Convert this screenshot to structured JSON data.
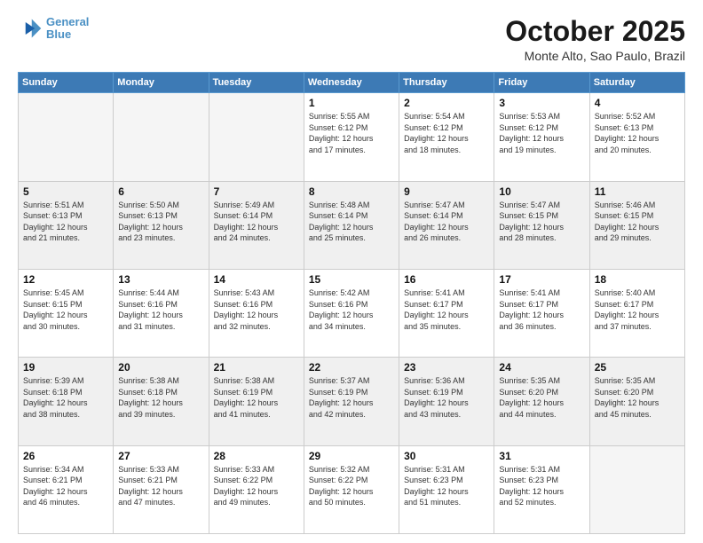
{
  "header": {
    "logo_line1": "General",
    "logo_line2": "Blue",
    "month": "October 2025",
    "location": "Monte Alto, Sao Paulo, Brazil"
  },
  "weekdays": [
    "Sunday",
    "Monday",
    "Tuesday",
    "Wednesday",
    "Thursday",
    "Friday",
    "Saturday"
  ],
  "weeks": [
    [
      {
        "day": "",
        "info": ""
      },
      {
        "day": "",
        "info": ""
      },
      {
        "day": "",
        "info": ""
      },
      {
        "day": "1",
        "info": "Sunrise: 5:55 AM\nSunset: 6:12 PM\nDaylight: 12 hours\nand 17 minutes."
      },
      {
        "day": "2",
        "info": "Sunrise: 5:54 AM\nSunset: 6:12 PM\nDaylight: 12 hours\nand 18 minutes."
      },
      {
        "day": "3",
        "info": "Sunrise: 5:53 AM\nSunset: 6:12 PM\nDaylight: 12 hours\nand 19 minutes."
      },
      {
        "day": "4",
        "info": "Sunrise: 5:52 AM\nSunset: 6:13 PM\nDaylight: 12 hours\nand 20 minutes."
      }
    ],
    [
      {
        "day": "5",
        "info": "Sunrise: 5:51 AM\nSunset: 6:13 PM\nDaylight: 12 hours\nand 21 minutes."
      },
      {
        "day": "6",
        "info": "Sunrise: 5:50 AM\nSunset: 6:13 PM\nDaylight: 12 hours\nand 23 minutes."
      },
      {
        "day": "7",
        "info": "Sunrise: 5:49 AM\nSunset: 6:14 PM\nDaylight: 12 hours\nand 24 minutes."
      },
      {
        "day": "8",
        "info": "Sunrise: 5:48 AM\nSunset: 6:14 PM\nDaylight: 12 hours\nand 25 minutes."
      },
      {
        "day": "9",
        "info": "Sunrise: 5:47 AM\nSunset: 6:14 PM\nDaylight: 12 hours\nand 26 minutes."
      },
      {
        "day": "10",
        "info": "Sunrise: 5:47 AM\nSunset: 6:15 PM\nDaylight: 12 hours\nand 28 minutes."
      },
      {
        "day": "11",
        "info": "Sunrise: 5:46 AM\nSunset: 6:15 PM\nDaylight: 12 hours\nand 29 minutes."
      }
    ],
    [
      {
        "day": "12",
        "info": "Sunrise: 5:45 AM\nSunset: 6:15 PM\nDaylight: 12 hours\nand 30 minutes."
      },
      {
        "day": "13",
        "info": "Sunrise: 5:44 AM\nSunset: 6:16 PM\nDaylight: 12 hours\nand 31 minutes."
      },
      {
        "day": "14",
        "info": "Sunrise: 5:43 AM\nSunset: 6:16 PM\nDaylight: 12 hours\nand 32 minutes."
      },
      {
        "day": "15",
        "info": "Sunrise: 5:42 AM\nSunset: 6:16 PM\nDaylight: 12 hours\nand 34 minutes."
      },
      {
        "day": "16",
        "info": "Sunrise: 5:41 AM\nSunset: 6:17 PM\nDaylight: 12 hours\nand 35 minutes."
      },
      {
        "day": "17",
        "info": "Sunrise: 5:41 AM\nSunset: 6:17 PM\nDaylight: 12 hours\nand 36 minutes."
      },
      {
        "day": "18",
        "info": "Sunrise: 5:40 AM\nSunset: 6:17 PM\nDaylight: 12 hours\nand 37 minutes."
      }
    ],
    [
      {
        "day": "19",
        "info": "Sunrise: 5:39 AM\nSunset: 6:18 PM\nDaylight: 12 hours\nand 38 minutes."
      },
      {
        "day": "20",
        "info": "Sunrise: 5:38 AM\nSunset: 6:18 PM\nDaylight: 12 hours\nand 39 minutes."
      },
      {
        "day": "21",
        "info": "Sunrise: 5:38 AM\nSunset: 6:19 PM\nDaylight: 12 hours\nand 41 minutes."
      },
      {
        "day": "22",
        "info": "Sunrise: 5:37 AM\nSunset: 6:19 PM\nDaylight: 12 hours\nand 42 minutes."
      },
      {
        "day": "23",
        "info": "Sunrise: 5:36 AM\nSunset: 6:19 PM\nDaylight: 12 hours\nand 43 minutes."
      },
      {
        "day": "24",
        "info": "Sunrise: 5:35 AM\nSunset: 6:20 PM\nDaylight: 12 hours\nand 44 minutes."
      },
      {
        "day": "25",
        "info": "Sunrise: 5:35 AM\nSunset: 6:20 PM\nDaylight: 12 hours\nand 45 minutes."
      }
    ],
    [
      {
        "day": "26",
        "info": "Sunrise: 5:34 AM\nSunset: 6:21 PM\nDaylight: 12 hours\nand 46 minutes."
      },
      {
        "day": "27",
        "info": "Sunrise: 5:33 AM\nSunset: 6:21 PM\nDaylight: 12 hours\nand 47 minutes."
      },
      {
        "day": "28",
        "info": "Sunrise: 5:33 AM\nSunset: 6:22 PM\nDaylight: 12 hours\nand 49 minutes."
      },
      {
        "day": "29",
        "info": "Sunrise: 5:32 AM\nSunset: 6:22 PM\nDaylight: 12 hours\nand 50 minutes."
      },
      {
        "day": "30",
        "info": "Sunrise: 5:31 AM\nSunset: 6:23 PM\nDaylight: 12 hours\nand 51 minutes."
      },
      {
        "day": "31",
        "info": "Sunrise: 5:31 AM\nSunset: 6:23 PM\nDaylight: 12 hours\nand 52 minutes."
      },
      {
        "day": "",
        "info": ""
      }
    ]
  ]
}
